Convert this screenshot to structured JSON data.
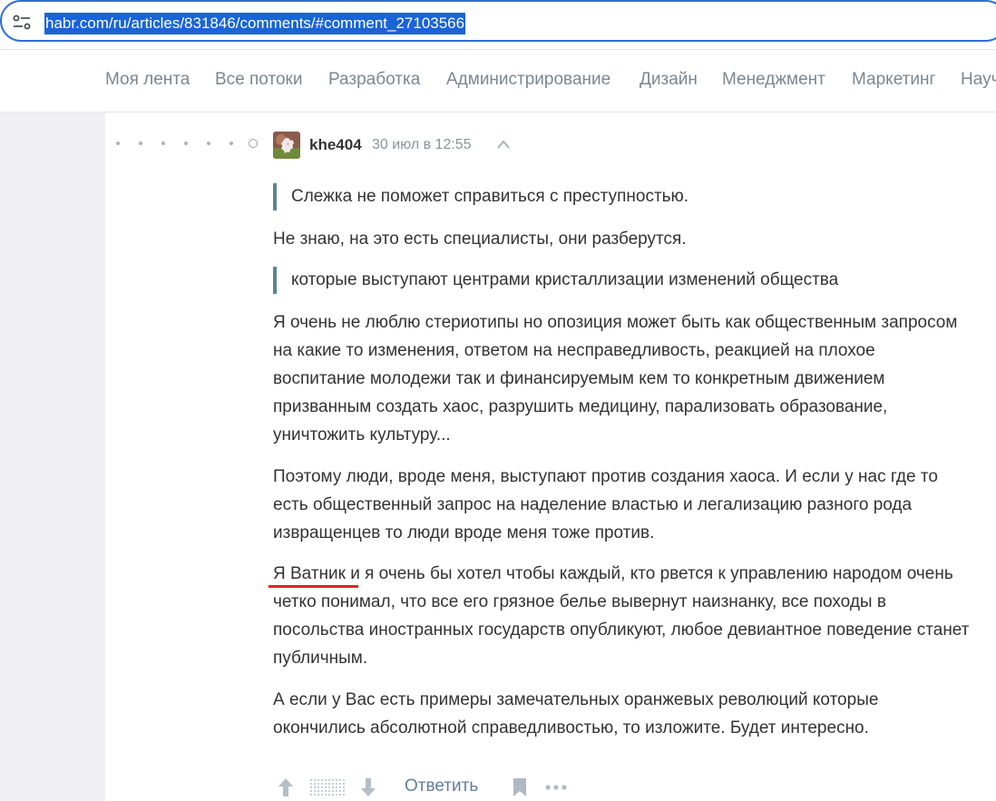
{
  "browser": {
    "url": "habr.com/ru/articles/831846/comments/#comment_27103566",
    "site_icon": "page-info-icon",
    "accent_color": "#1a64d7"
  },
  "nav": {
    "items": [
      "Моя лента",
      "Все потоки",
      "Разработка",
      "Администрирование",
      "Дизайн",
      "Менеджмент",
      "Маркетинг",
      "Науч"
    ]
  },
  "comment": {
    "author": "khe404",
    "date": "30 июл в 12:55",
    "quote1": "Слежка не поможет справиться с преступностью.",
    "para1": "Не знаю, на это есть специалисты, они разберутся.",
    "quote2": "которые выступают центрами кристаллизации изменений общества",
    "para2": "Я очень не люблю стериотипы но опозиция может быть как общественным запросом на какие то изменения, ответом на несправедливость, реакцией на плохое воспитание молодежи так и финансируемым кем то конкретным движением призванным создать хаос, разрушить медицину, парализовать образование, уничтожить культуру...",
    "para3": "Поэтому люди, вроде меня, выступают против создания хаоса. И если у нас где то есть общественный запрос на наделение властью и легализацию разного рода извращенцев то люди вроде меня тоже против.",
    "para4": "Я Ватник и я очень бы хотел чтобы каждый, кто рвется к управлению народом очень четко понимал, что все его грязное белье вывернут наизнанку, все походы в посольства иностранных государств опубликуют, любое девиантное поведение станет публичным.",
    "para5": "А если у Вас есть примеры замечательных оранжевых революций которые окончились абсолютной справедливостью, то изложите. Будет интересно.",
    "underline_color": "#e8202a"
  },
  "actions": {
    "reply_label": "Ответить",
    "icons": [
      "arrow-up-icon",
      "arrow-down-icon",
      "bookmark-icon",
      "more-icon"
    ]
  }
}
